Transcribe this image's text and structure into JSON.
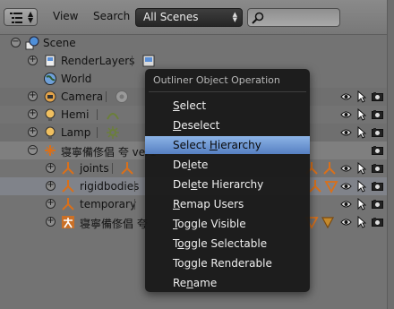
{
  "header": {
    "menus": [
      "View",
      "Search"
    ],
    "scene_selector": "All Scenes"
  },
  "tree": {
    "rows": [
      {
        "label": "Scene",
        "icon": "scene-icon"
      },
      {
        "label": "RenderLayers",
        "icon": "render-layers-icon"
      },
      {
        "label": "World",
        "icon": "world-icon"
      },
      {
        "label": "Camera",
        "icon": "camera-object-icon"
      },
      {
        "label": "Hemi",
        "icon": "lamp-icon"
      },
      {
        "label": "Lamp",
        "icon": "lamp-icon"
      },
      {
        "label": "寝寧備俢倡 夸 ver1",
        "icon": "armature-icon"
      },
      {
        "label": "joints",
        "icon": "armature-icon"
      },
      {
        "label": "rigidbodies",
        "icon": "armature-icon"
      },
      {
        "label": "temporary",
        "icon": "armature-icon"
      },
      {
        "label": "寝寧備俢倡 夸",
        "icon": "armature-icon"
      }
    ]
  },
  "popup": {
    "title": "Outliner Object Operation",
    "items": [
      {
        "pre": "",
        "key": "S",
        "post": "elect"
      },
      {
        "pre": "",
        "key": "D",
        "post": "eselect"
      },
      {
        "pre": "Select ",
        "key": "H",
        "post": "ierarchy"
      },
      {
        "pre": "De",
        "key": "l",
        "post": "ete"
      },
      {
        "pre": "Del",
        "key": "e",
        "post": "te Hierarchy"
      },
      {
        "pre": "",
        "key": "R",
        "post": "emap Users"
      },
      {
        "pre": "",
        "key": "T",
        "post": "oggle Visible"
      },
      {
        "pre": "T",
        "key": "o",
        "post": "ggle Selectable"
      },
      {
        "pre": "To",
        "key": "g",
        "post": "gle Renderable"
      },
      {
        "pre": "Re",
        "key": "n",
        "post": "ame"
      }
    ],
    "active_index": 2
  },
  "colors": {
    "header_bg": "#808080",
    "tree_bg": "#737373",
    "popup_bg": "#181818",
    "highlight": "#5680c2",
    "armature_orange": "#d9701a"
  }
}
